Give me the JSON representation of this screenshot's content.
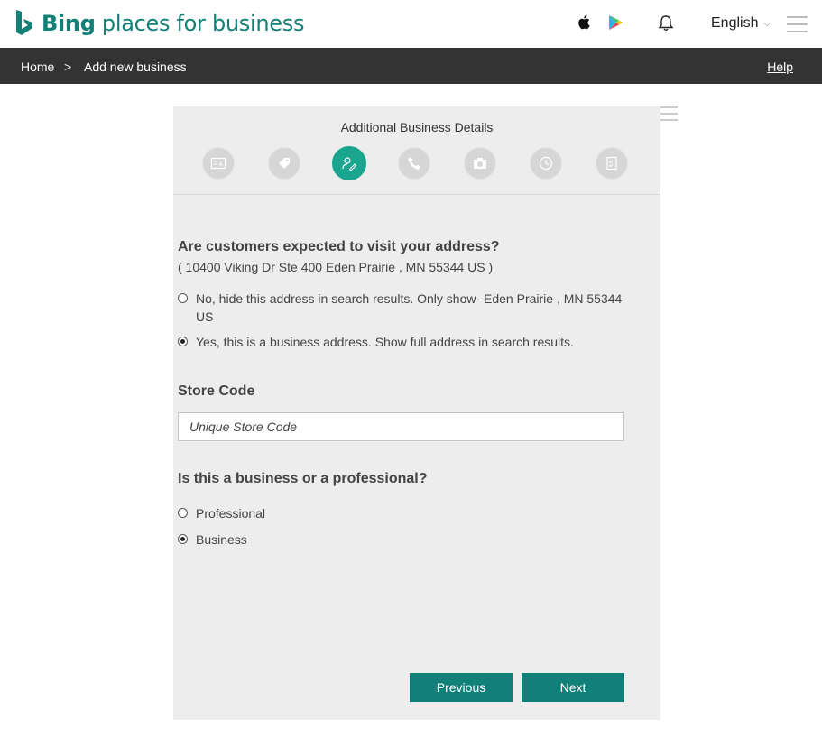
{
  "header": {
    "logo_bold": "Bing",
    "logo_rest": " places for business",
    "apple_icon": "apple-icon",
    "play_icon": "google-play-icon",
    "bell_icon": "bell-icon",
    "language": "English",
    "language_chevron": "⌵",
    "menu_icon": "hamburger-icon"
  },
  "breadcrumb": {
    "home": "Home",
    "separator": ">",
    "current": "Add new business",
    "help": "Help"
  },
  "wizard": {
    "title": "Additional Business Details",
    "steps": [
      "business-card-icon",
      "tag-icon",
      "person-edit-icon",
      "phone-icon",
      "camera-icon",
      "clock-icon",
      "checklist-icon"
    ],
    "active_step": 2
  },
  "visit": {
    "question": "Are customers expected to visit your address?",
    "address": "( 10400 Viking Dr Ste 400 Eden Prairie , MN 55344 US )",
    "option_hide": "No, hide this address in search results. Only show- Eden Prairie , MN 55344 US",
    "option_show": "Yes, this is a business address. Show full address in search results.",
    "selected": "show"
  },
  "store": {
    "label": "Store Code",
    "placeholder": "Unique Store Code"
  },
  "type": {
    "question": "Is this a business or a professional?",
    "option_professional": "Professional",
    "option_business": "Business",
    "selected": "business"
  },
  "buttons": {
    "previous": "Previous",
    "next": "Next"
  },
  "colors": {
    "brand": "#138078",
    "accent_step": "#1aa58e",
    "button": "#108079",
    "nav_bar": "#333333"
  }
}
